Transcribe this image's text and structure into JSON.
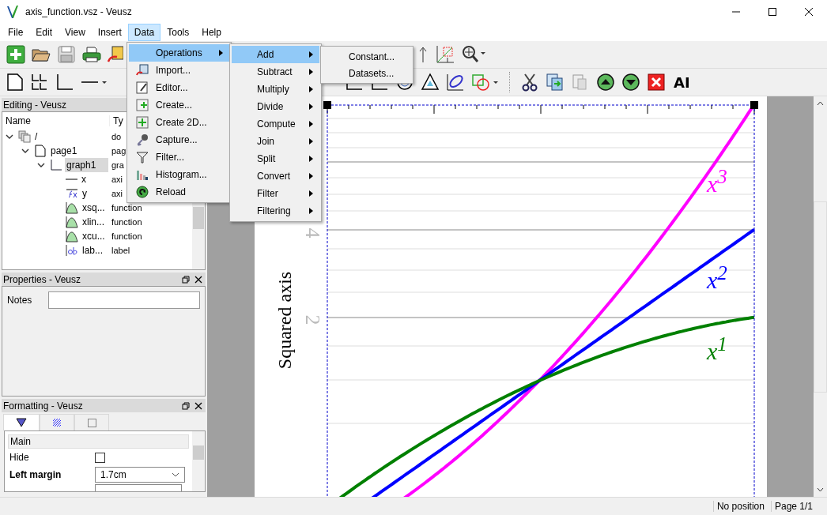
{
  "window": {
    "title": "axis_function.vsz - Veusz"
  },
  "menubar": [
    {
      "label": "File",
      "selected": false
    },
    {
      "label": "Edit",
      "selected": false
    },
    {
      "label": "View",
      "selected": false
    },
    {
      "label": "Insert",
      "selected": false
    },
    {
      "label": "Data",
      "selected": true
    },
    {
      "label": "Tools",
      "selected": false
    },
    {
      "label": "Help",
      "selected": false
    }
  ],
  "toolbar": {
    "text_tool": "AI"
  },
  "editing_panel": {
    "title": "Editing - Veusz",
    "columns": [
      "Name",
      "Ty"
    ],
    "tree": [
      {
        "name": "/",
        "type": "do",
        "kind": "document",
        "expanded": true,
        "selected": false,
        "children": [
          {
            "name": "page1",
            "type": "pag",
            "kind": "page",
            "expanded": true,
            "selected": false,
            "children": [
              {
                "name": "graph1",
                "type": "gra",
                "kind": "graph",
                "expanded": true,
                "selected": true,
                "children": [
                  {
                    "name": "x",
                    "type": "axi",
                    "kind": "axis",
                    "selected": false
                  },
                  {
                    "name": "y",
                    "type": "axi",
                    "kind": "axis-function",
                    "selected": false
                  },
                  {
                    "name": "xsq...",
                    "type": "function",
                    "kind": "function",
                    "selected": false
                  },
                  {
                    "name": "xlin...",
                    "type": "function",
                    "kind": "function",
                    "selected": false
                  },
                  {
                    "name": "xcu...",
                    "type": "function",
                    "kind": "function",
                    "selected": false
                  },
                  {
                    "name": "lab...",
                    "type": "label",
                    "kind": "label",
                    "selected": false
                  }
                ]
              }
            ]
          }
        ]
      }
    ]
  },
  "properties_panel": {
    "title": "Properties - Veusz",
    "fields": [
      {
        "label": "Notes"
      }
    ]
  },
  "formatting_panel": {
    "title": "Formatting - Veusz",
    "tabs": [
      {
        "kind": "marker",
        "selected": true
      },
      {
        "kind": "hatch",
        "selected": false
      },
      {
        "kind": "box",
        "selected": false
      }
    ],
    "group": "Main",
    "rows": [
      {
        "kind": "checkbox",
        "label": "Hide",
        "checked": false,
        "modified": false
      },
      {
        "kind": "dropdown",
        "label": "Left margin",
        "value": "1.7cm",
        "modified": true
      }
    ]
  },
  "plot": {
    "ylabel": "Squared axis",
    "tick_labels": [
      "4",
      "2"
    ],
    "curves": [
      {
        "label": "x$^{3}$",
        "color": "#ff00ff"
      },
      {
        "label": "x$^{2}$",
        "color": "#0000ff"
      },
      {
        "label": "x$^{1}$",
        "color": "#008000"
      }
    ]
  },
  "data_menu": [
    {
      "label": "Operations",
      "kind": "none",
      "submenu": true,
      "selected": true
    },
    {
      "label": "Import...",
      "kind": "import",
      "submenu": false,
      "selected": false
    },
    {
      "label": "Editor...",
      "kind": "editor",
      "submenu": false,
      "selected": false
    },
    {
      "label": "Create...",
      "kind": "create",
      "submenu": false,
      "selected": false
    },
    {
      "label": "Create 2D...",
      "kind": "create2d",
      "submenu": false,
      "selected": false
    },
    {
      "label": "Capture...",
      "kind": "capture",
      "submenu": false,
      "selected": false
    },
    {
      "label": "Filter...",
      "kind": "filter",
      "submenu": false,
      "selected": false
    },
    {
      "label": "Histogram...",
      "kind": "histogram",
      "submenu": false,
      "selected": false
    },
    {
      "label": "Reload",
      "kind": "reload",
      "submenu": false,
      "selected": false
    }
  ],
  "operations_menu": [
    {
      "label": "Add",
      "submenu": true,
      "selected": true
    },
    {
      "label": "Subtract",
      "submenu": true,
      "selected": false
    },
    {
      "label": "Multiply",
      "submenu": true,
      "selected": false
    },
    {
      "label": "Divide",
      "submenu": true,
      "selected": false
    },
    {
      "label": "Compute",
      "submenu": true,
      "selected": false
    },
    {
      "label": "Join",
      "submenu": true,
      "selected": false
    },
    {
      "label": "Split",
      "submenu": true,
      "selected": false
    },
    {
      "label": "Convert",
      "submenu": true,
      "selected": false
    },
    {
      "label": "Filter",
      "submenu": true,
      "selected": false
    },
    {
      "label": "Filtering",
      "submenu": true,
      "selected": false
    }
  ],
  "add_menu": [
    {
      "label": "Constant...",
      "selected": false
    },
    {
      "label": "Datasets...",
      "selected": false
    }
  ],
  "status_bar": {
    "position": "No position",
    "page": "Page 1/1"
  }
}
